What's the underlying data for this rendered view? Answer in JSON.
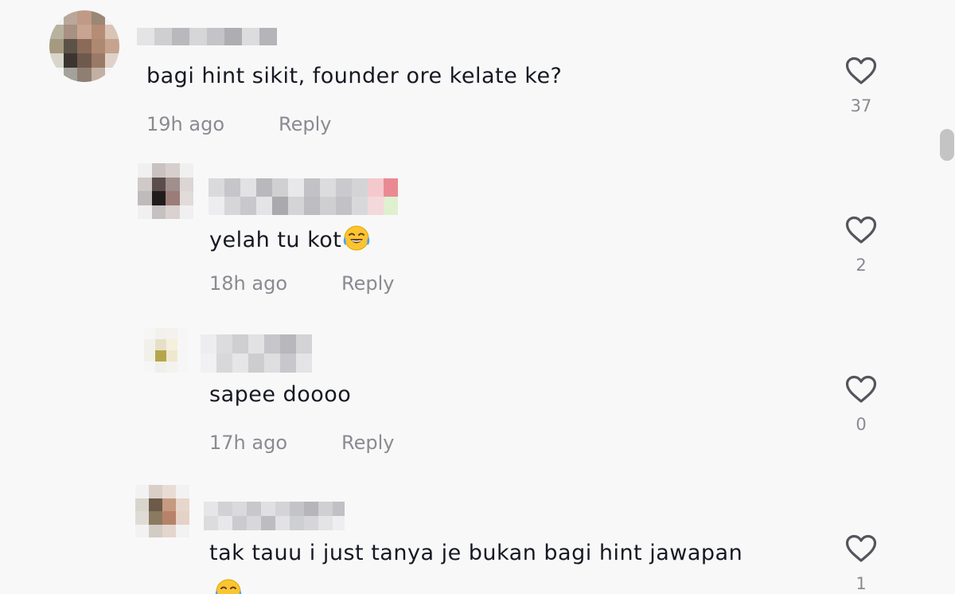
{
  "comments": [
    {
      "text": "bagi hint sikit, founder ore kelate ke?",
      "time": "19h ago",
      "reply_label": "Reply",
      "likes": "37",
      "avatar_icon": "pixelated-avatar-icon",
      "username_blurred": true
    },
    {
      "text": "yelah tu kot",
      "emoji": "face-with-tears-of-joy-icon",
      "time": "18h ago",
      "reply_label": "Reply",
      "likes": "2",
      "avatar_icon": "pixelated-avatar-icon",
      "username_blurred": true
    },
    {
      "text": "sapee doooo",
      "time": "17h ago",
      "reply_label": "Reply",
      "likes": "0",
      "avatar_icon": "pixelated-avatar-icon",
      "username_blurred": true
    },
    {
      "text": "tak tauu i just tanya je bukan bagi hint jawapan",
      "emoji": "face-with-tears-of-joy-icon",
      "likes": "1",
      "avatar_icon": "pixelated-avatar-icon",
      "username_blurred": true
    }
  ],
  "colors": {
    "background": "#f8f8f8",
    "text": "#161823",
    "muted": "#8a8b91",
    "heart_stroke": "#54555c"
  }
}
